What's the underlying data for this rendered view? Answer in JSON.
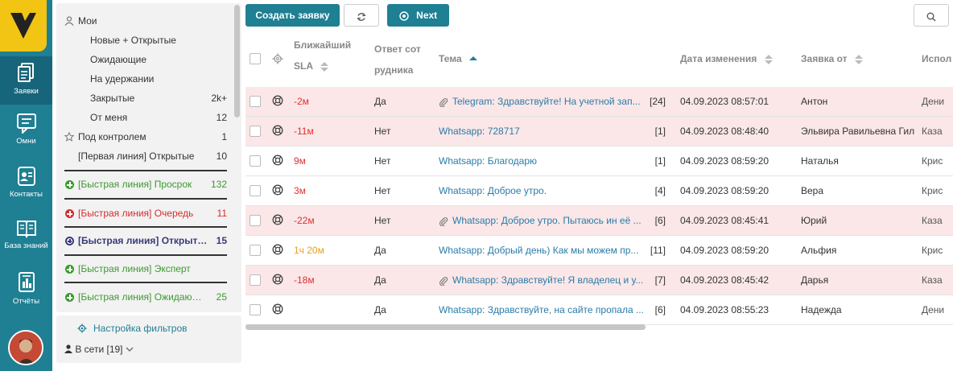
{
  "rail": {
    "items": [
      {
        "label": "Заявки",
        "icon": "tickets-icon"
      },
      {
        "label": "Омни",
        "icon": "chat-icon"
      },
      {
        "label": "Контакты",
        "icon": "contacts-icon"
      },
      {
        "label": "База знаний",
        "icon": "book-icon"
      },
      {
        "label": "Отчёты",
        "icon": "report-icon"
      }
    ]
  },
  "filters": {
    "mine": "Мои",
    "new_open": "Новые + Открытые",
    "waiting": "Ожидающие",
    "on_hold": "На удержании",
    "closed": "Закрытые",
    "closed_count": "2k+",
    "from_me": "От меня",
    "from_me_count": "12",
    "under_control": "Под контролем",
    "under_control_count": "1",
    "first_line": "[Первая линия] Открытые",
    "first_line_count": "10",
    "fast_overdue": "[Быстрая линия] Просрок",
    "fast_overdue_count": "132",
    "fast_queue": "[Быстрая линия] Очередь",
    "fast_queue_count": "11",
    "fast_open": "[Быстрая линия] Открытые",
    "fast_open_count": "15",
    "fast_expert": "[Быстрая линия] Эксперт",
    "fast_waiting": "[Быстрая линия] Ожидающие",
    "fast_waiting_count": "25",
    "settings": "Настройка фильтров",
    "online": "В сети [19]"
  },
  "toolbar": {
    "create": "Создать заявку",
    "next": "Next"
  },
  "columns": {
    "sla_1": "Ближайший",
    "sla_2": "SLA",
    "resp_1": "Ответ сот",
    "resp_2": "рудника",
    "topic": "Тема",
    "modified": "Дата изменения",
    "from": "Заявка от",
    "assignee": "Испол"
  },
  "rows": [
    {
      "sla": "-2м",
      "resp": "Да",
      "topic": "Telegram: Здравствуйте! На учетной зап...",
      "count": "[24]",
      "date": "04.09.2023 08:57:01",
      "from": "Антон",
      "assignee": "Дени"
    },
    {
      "sla": "-11м",
      "resp": "Нет",
      "topic": "Whatsapp: 728717",
      "count": "[1]",
      "date": "04.09.2023 08:48:40",
      "from": "Эльвира Равильевна Гил",
      "assignee": "Каза"
    },
    {
      "sla": "9м",
      "resp": "Нет",
      "topic": "Whatsapp: Благодарю",
      "count": "[1]",
      "date": "04.09.2023 08:59:20",
      "from": "Наталья",
      "assignee": "Крис"
    },
    {
      "sla": "3м",
      "resp": "Нет",
      "topic": "Whatsapp: Доброе утро.",
      "count": "[4]",
      "date": "04.09.2023 08:59:20",
      "from": "Вера",
      "assignee": "Крис"
    },
    {
      "sla": "-22м",
      "resp": "Нет",
      "topic": "Whatsapp: Доброе утро. Пытаюсь ин её ...",
      "count": "[6]",
      "date": "04.09.2023 08:45:41",
      "from": "Юрий",
      "assignee": "Каза"
    },
    {
      "sla": "1ч 20м",
      "resp": "Да",
      "topic": "Whatsapp: Добрый день) Как мы можем пр...",
      "count": "[11]",
      "date": "04.09.2023 08:59:20",
      "from": "Альфия",
      "assignee": "Крис"
    },
    {
      "sla": "-18м",
      "resp": "Да",
      "topic": "Whatsapp: Здравствуйте! Я владелец и у...",
      "count": "[7]",
      "date": "04.09.2023 08:45:42",
      "from": "Дарья",
      "assignee": "Каза"
    },
    {
      "sla": "",
      "resp": "Да",
      "topic": "Whatsapp: Здравствуйте, на сайте пропала ...",
      "count": "[6]",
      "date": "04.09.2023 08:55:23",
      "from": "Надежда",
      "assignee": "Дени"
    }
  ],
  "colors": {
    "accent": "#1f7f93",
    "logo": "#f2c413",
    "overdue_row": "#fbe7e8",
    "sla_red": "#e03030",
    "sla_orange": "#e8a020",
    "link": "#2a7ca8"
  }
}
